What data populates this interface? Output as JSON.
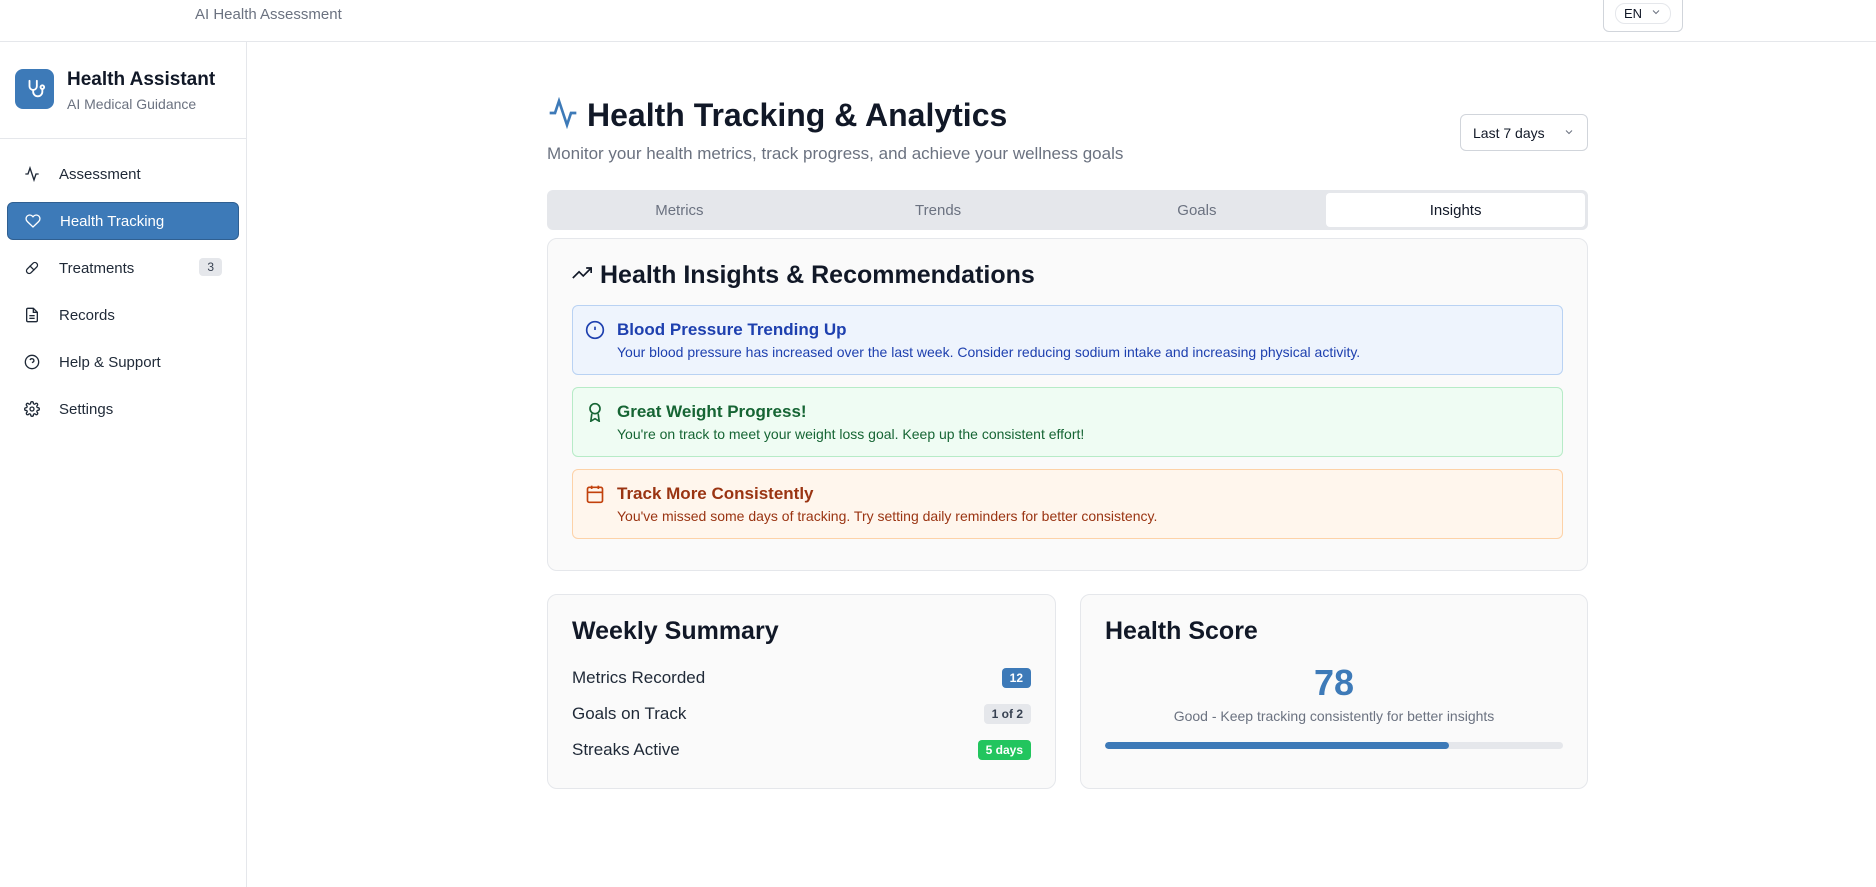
{
  "topbar": {
    "app_title": "AI Health Assessment",
    "language": "EN"
  },
  "brand": {
    "name": "Health Assistant",
    "subtitle": "AI Medical Guidance"
  },
  "sidebar": {
    "items": [
      {
        "label": "Assessment",
        "icon": "activity-icon"
      },
      {
        "label": "Health Tracking",
        "icon": "heart-icon",
        "active": true
      },
      {
        "label": "Treatments",
        "icon": "pill-icon",
        "badge": "3"
      },
      {
        "label": "Records",
        "icon": "file-text-icon"
      },
      {
        "label": "Help & Support",
        "icon": "help-circle-icon"
      },
      {
        "label": "Settings",
        "icon": "gear-icon"
      }
    ]
  },
  "header": {
    "title": "Health Tracking & Analytics",
    "subtitle": "Monitor your health metrics, track progress, and achieve your wellness goals",
    "period": "Last 7 days"
  },
  "tabs": [
    {
      "label": "Metrics"
    },
    {
      "label": "Trends"
    },
    {
      "label": "Goals"
    },
    {
      "label": "Insights",
      "active": true
    }
  ],
  "insights": {
    "title": "Health Insights & Recommendations",
    "alerts": [
      {
        "title": "Blood Pressure Trending Up",
        "text": "Your blood pressure has increased over the last week. Consider reducing sodium intake and increasing physical activity.",
        "tone": "blue",
        "icon": "alert-circle-icon"
      },
      {
        "title": "Great Weight Progress!",
        "text": "You're on track to meet your weight loss goal. Keep up the consistent effort!",
        "tone": "green",
        "icon": "award-icon"
      },
      {
        "title": "Track More Consistently",
        "text": "You've missed some days of tracking. Try setting daily reminders for better consistency.",
        "tone": "orange",
        "icon": "calendar-icon"
      }
    ]
  },
  "weekly_summary": {
    "title": "Weekly Summary",
    "rows": [
      {
        "label": "Metrics Recorded",
        "value": "12"
      },
      {
        "label": "Goals on Track",
        "value": "1 of 2"
      },
      {
        "label": "Streaks Active",
        "value": "5 days"
      }
    ]
  },
  "health_score": {
    "title": "Health Score",
    "value": "78",
    "text": "Good - Keep tracking consistently for better insights",
    "progress_percent": 75
  },
  "colors": {
    "accent": "#3d7ab8",
    "success": "#22c55e"
  }
}
